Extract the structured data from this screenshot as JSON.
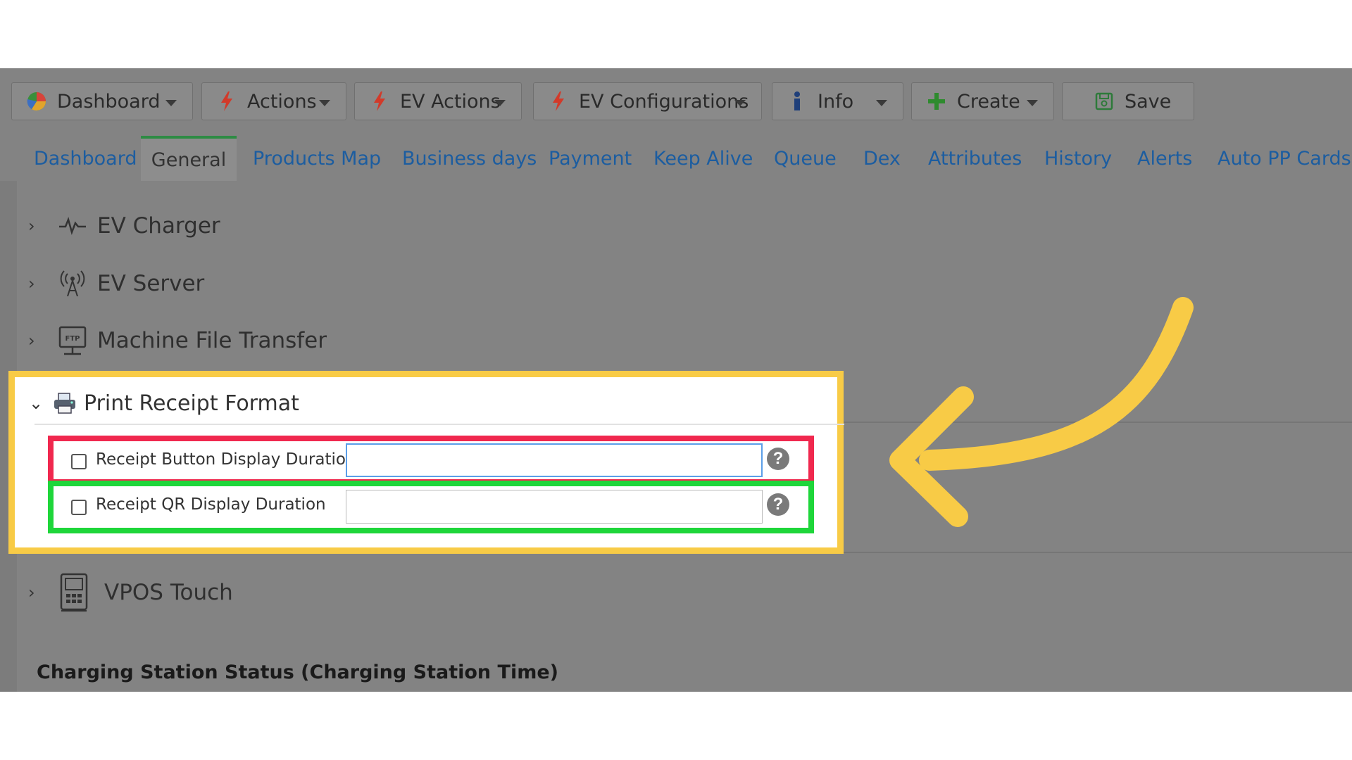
{
  "toolbar": {
    "buttons": [
      {
        "label": "Dashboard",
        "icon": "pie-chart-icon",
        "dropdown": true
      },
      {
        "label": "Actions",
        "icon": "lightning-icon",
        "dropdown": true
      },
      {
        "label": "EV Actions",
        "icon": "lightning-icon",
        "dropdown": true
      },
      {
        "label": "EV Configurations",
        "icon": "lightning-icon",
        "dropdown": true
      },
      {
        "label": "Info",
        "icon": "info-icon",
        "dropdown": true
      },
      {
        "label": "Create",
        "icon": "plus-icon",
        "dropdown": true
      },
      {
        "label": "Save",
        "icon": "save-icon",
        "dropdown": false
      }
    ]
  },
  "tabs": {
    "items": [
      "Dashboard",
      "General",
      "Products Map",
      "Business days",
      "Payment",
      "Keep Alive",
      "Queue",
      "Dex",
      "Attributes",
      "History",
      "Alerts",
      "Auto PP Cards"
    ],
    "active": "General"
  },
  "sections": {
    "ev_charger": "EV Charger",
    "ev_server": "EV Server",
    "machine_file_transfer": "Machine File Transfer",
    "print_receipt_format": "Print Receipt Format",
    "vpos_touch": "VPOS Touch"
  },
  "print_receipt": {
    "fields": [
      {
        "label": "Receipt Button Display Duration",
        "value": "",
        "checked": false
      },
      {
        "label": "Receipt QR Display Duration",
        "value": "",
        "checked": false
      }
    ]
  },
  "footer": {
    "title": "Charging Station Status (Charging Station Time)"
  },
  "colors": {
    "highlight_panel": "#f8cb46",
    "red_box": "#f0284e",
    "green_box": "#1ed63a",
    "arrow": "#f8cb46",
    "tab_link": "#1c5da0",
    "active_tab_border": "#2e8b44"
  }
}
